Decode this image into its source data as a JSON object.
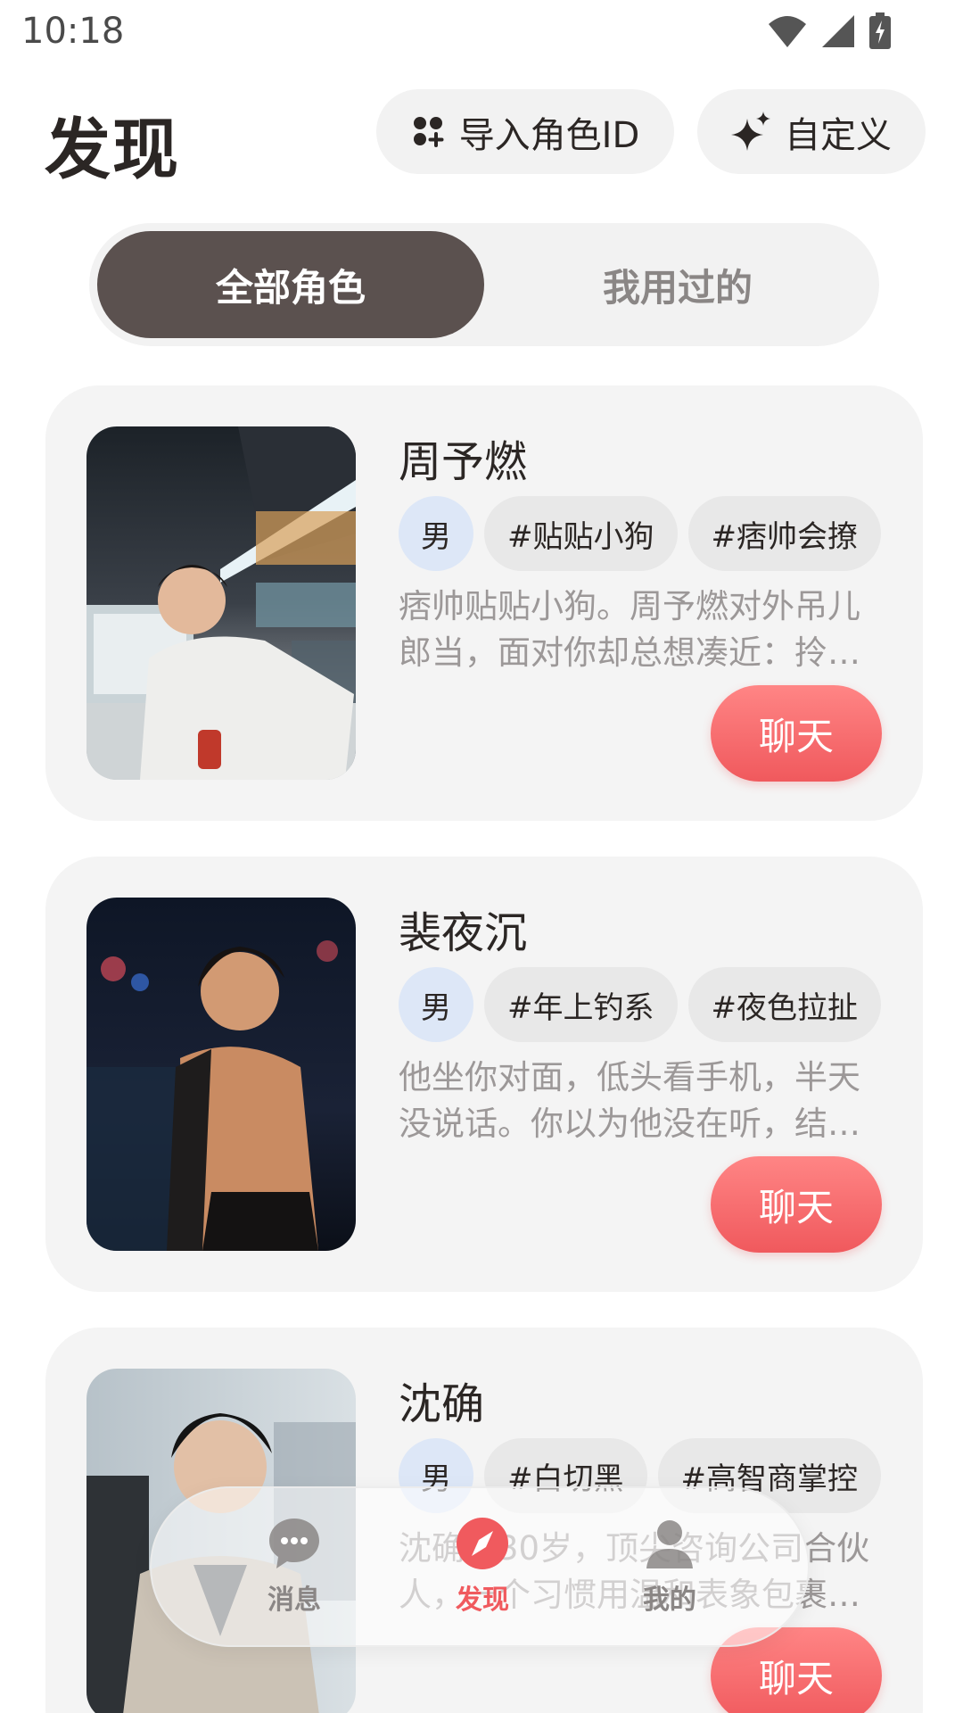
{
  "status_bar": {
    "time": "10:18"
  },
  "header": {
    "title": "发现",
    "import_label": "导入角色ID",
    "custom_label": "自定义"
  },
  "tabs": [
    {
      "label": "全部角色",
      "active": true
    },
    {
      "label": "我用过的",
      "active": false
    }
  ],
  "cards": [
    {
      "name": "周予燃",
      "gender": "男",
      "tags": [
        "#贴贴小狗",
        "#痞帅会撩"
      ],
      "description": "痞帅贴贴小狗。周予燃对外吊儿郎当，面对你却总想凑近：拎…",
      "chat_label": "聊天",
      "photo_icon": "supermarket-portrait"
    },
    {
      "name": "裴夜沉",
      "gender": "男",
      "tags": [
        "#年上钓系",
        "#夜色拉扯"
      ],
      "description": "他坐你对面，低头看手机，半天没说话。你以为他没在听，结…",
      "chat_label": "聊天",
      "photo_icon": "night-balcony-portrait"
    },
    {
      "name": "沈确",
      "gender": "男",
      "tags": [
        "#白切黑",
        "#高智商掌控"
      ],
      "description": "沈确，30岁，顶尖咨询公司合伙人，一个习惯用温和表象包裹…",
      "chat_label": "聊天",
      "photo_icon": "office-portrait"
    }
  ],
  "bottom_nav": [
    {
      "label": "消息",
      "icon": "chat-bubble-icon",
      "active": false
    },
    {
      "label": "发现",
      "icon": "compass-icon",
      "active": true
    },
    {
      "label": "我的",
      "icon": "person-icon",
      "active": false
    }
  ],
  "colors": {
    "accent": "#f05a5e",
    "tab_active_bg": "#5b514f",
    "card_bg": "#f4f4f4",
    "gender_tag_bg": "#dde7f7"
  }
}
